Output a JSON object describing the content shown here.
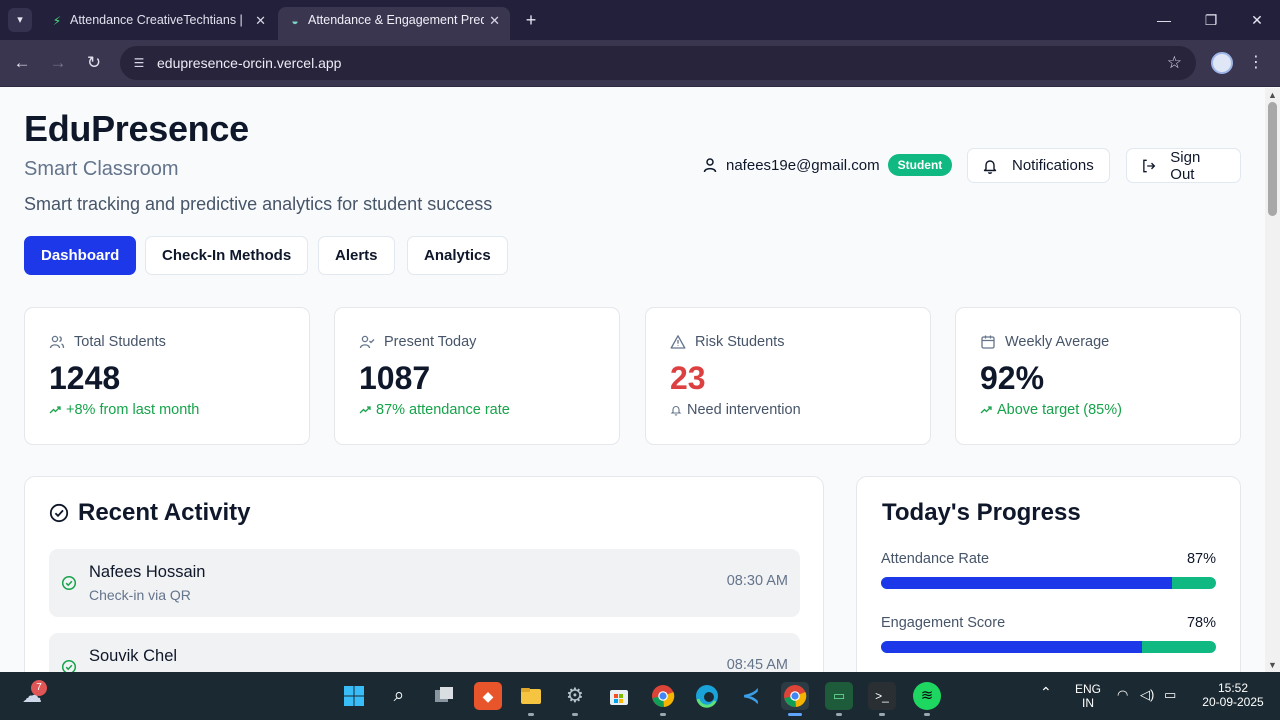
{
  "browser": {
    "tabs": [
      {
        "title": "Attendance CreativeTechtians | Lovable",
        "active": false
      },
      {
        "title": "Attendance & Engagement Predictor",
        "active": true
      }
    ],
    "url": "edupresence-orcin.vercel.app"
  },
  "header": {
    "brand": "EduPresence",
    "subtitle": "Smart Classroom",
    "tagline": "Smart tracking and predictive analytics for student success",
    "user_email": "nafees19e@gmail.com",
    "role_badge": "Student",
    "notifications_label": "Notifications",
    "signout_label": "Sign Out"
  },
  "nav": {
    "tabs": [
      {
        "label": "Dashboard",
        "active": true
      },
      {
        "label": "Check-In Methods",
        "active": false
      },
      {
        "label": "Alerts",
        "active": false
      },
      {
        "label": "Analytics",
        "active": false
      }
    ]
  },
  "stats": [
    {
      "label": "Total Students",
      "value": "1248",
      "note": "+8% from last month",
      "icon": "users-icon"
    },
    {
      "label": "Present Today",
      "value": "1087",
      "note": "87% attendance rate",
      "icon": "user-check-icon"
    },
    {
      "label": "Risk Students",
      "value": "23",
      "note": "Need intervention",
      "icon": "alert-triangle-icon"
    },
    {
      "label": "Weekly Average",
      "value": "92%",
      "note": "Above target (85%)",
      "icon": "calendar-icon"
    }
  ],
  "recent_activity": {
    "title": "Recent Activity",
    "items": [
      {
        "name": "Nafees Hossain",
        "detail": "Check-in via QR",
        "time": "08:30 AM"
      },
      {
        "name": "Souvik Chel",
        "detail": "",
        "time": "08:45 AM"
      }
    ]
  },
  "progress": {
    "title": "Today's Progress",
    "items": [
      {
        "label": "Attendance Rate",
        "value_text": "87%",
        "fraction": 0.87
      },
      {
        "label": "Engagement Score",
        "value_text": "78%",
        "fraction": 0.78
      }
    ]
  },
  "colors": {
    "primary": "#1d38e8",
    "success": "#10b981",
    "danger": "#dc4040"
  },
  "taskbar": {
    "weather_badge": "7",
    "language": "ENG",
    "region": "IN",
    "time": "15:52",
    "date": "20-09-2025"
  }
}
